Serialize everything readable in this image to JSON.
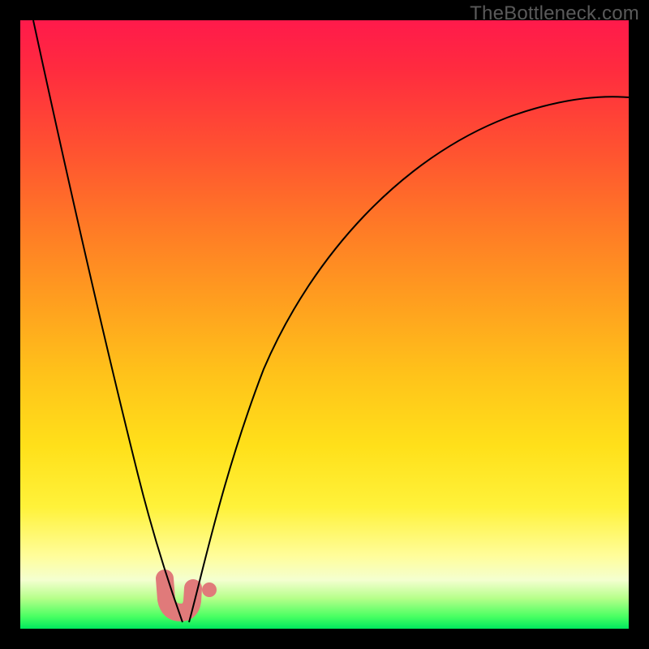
{
  "watermark": "TheBottleneck.com",
  "chart_data": {
    "type": "line",
    "title": "",
    "xlabel": "",
    "ylabel": "",
    "xlim": [
      0,
      100
    ],
    "ylim": [
      0,
      100
    ],
    "grid": false,
    "legend": false,
    "series": [
      {
        "name": "left-branch",
        "x": [
          2,
          5,
          8,
          11,
          14,
          17,
          20,
          22,
          24,
          25.5,
          26.5
        ],
        "y": [
          100,
          86,
          72,
          58,
          45,
          33,
          21,
          12,
          6,
          2,
          0
        ]
      },
      {
        "name": "right-branch",
        "x": [
          27.5,
          29,
          31,
          34,
          38,
          44,
          52,
          62,
          74,
          88,
          100
        ],
        "y": [
          0,
          5,
          12,
          22,
          34,
          47,
          59,
          69,
          77,
          83,
          87
        ]
      }
    ],
    "highlight": {
      "description": "pink U-shaped marker near minimum",
      "x_range": [
        23.5,
        27.5
      ],
      "y_range": [
        0,
        6
      ],
      "dot": {
        "x": 30,
        "y": 4
      }
    },
    "background_gradient": {
      "top": "#ff1a4b",
      "mid1": "#ff9e1f",
      "mid2": "#fff23a",
      "bottom": "#00e85e"
    }
  }
}
